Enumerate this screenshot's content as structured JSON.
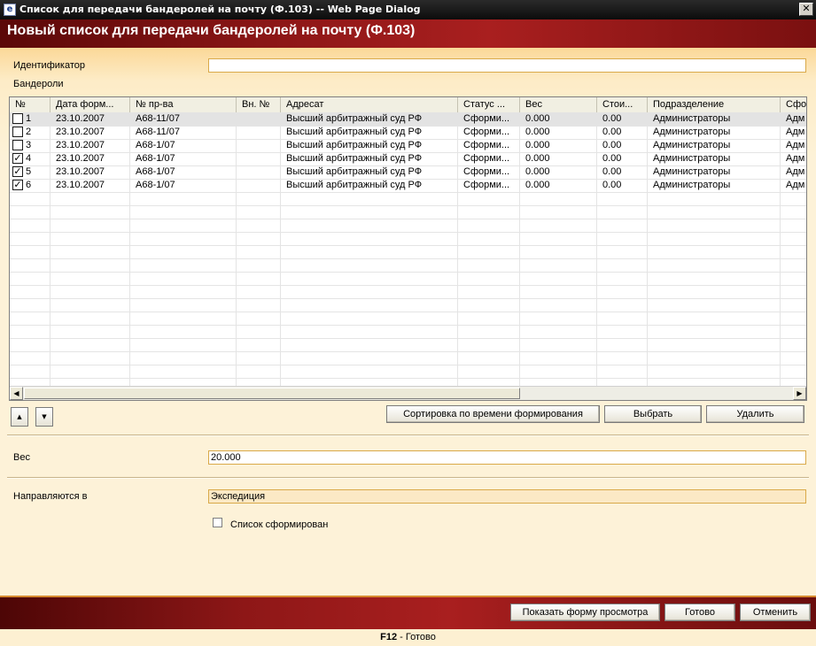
{
  "window": {
    "title": "Список для передачи бандеролей на почту (Ф.103) -- Web Page Dialog",
    "close_glyph": "✕"
  },
  "banner": {
    "title": "Новый список для передачи бандеролей на почту (Ф.103)"
  },
  "form": {
    "identifier_label": "Идентификатор",
    "identifier_value": "",
    "parcels_label": "Бандероли",
    "weight_label": "Вес",
    "weight_value": "20.000",
    "destination_label": "Направляются в",
    "destination_value": "Экспедиция",
    "list_formed_label": "Список сформирован",
    "list_formed_checked": false
  },
  "grid": {
    "columns": [
      "№",
      "Дата форм...",
      "№ пр-ва",
      "Вн. №",
      "Адресат",
      "Статус ...",
      "Вес",
      "Стои...",
      "Подразделение",
      "Сфо"
    ],
    "rows": [
      {
        "num": "1",
        "checked": false,
        "date": "23.10.2007",
        "case": "А68-11/07",
        "inner": "",
        "addressee": "Высший арбитражный суд РФ",
        "status": "Сформи...",
        "weight": "0.000",
        "cost": "0.00",
        "division": "Администраторы",
        "extra": "Адм"
      },
      {
        "num": "2",
        "checked": false,
        "date": "23.10.2007",
        "case": "А68-11/07",
        "inner": "",
        "addressee": "Высший арбитражный суд РФ",
        "status": "Сформи...",
        "weight": "0.000",
        "cost": "0.00",
        "division": "Администраторы",
        "extra": "Адм"
      },
      {
        "num": "3",
        "checked": false,
        "date": "23.10.2007",
        "case": "А68-1/07",
        "inner": "",
        "addressee": "Высший арбитражный суд РФ",
        "status": "Сформи...",
        "weight": "0.000",
        "cost": "0.00",
        "division": "Администраторы",
        "extra": "Адм"
      },
      {
        "num": "4",
        "checked": true,
        "date": "23.10.2007",
        "case": "А68-1/07",
        "inner": "",
        "addressee": "Высший арбитражный суд РФ",
        "status": "Сформи...",
        "weight": "0.000",
        "cost": "0.00",
        "division": "Администраторы",
        "extra": "Адм"
      },
      {
        "num": "5",
        "checked": true,
        "date": "23.10.2007",
        "case": "А68-1/07",
        "inner": "",
        "addressee": "Высший арбитражный суд РФ",
        "status": "Сформи...",
        "weight": "0.000",
        "cost": "0.00",
        "division": "Администраторы",
        "extra": "Адм"
      },
      {
        "num": "6",
        "checked": true,
        "date": "23.10.2007",
        "case": "А68-1/07",
        "inner": "",
        "addressee": "Высший арбитражный суд РФ",
        "status": "Сформи...",
        "weight": "0.000",
        "cost": "0.00",
        "division": "Администраторы",
        "extra": "Адм"
      }
    ],
    "selected_row": 0,
    "check_glyph": "✓",
    "scroll_left_glyph": "◀",
    "scroll_right_glyph": "▶"
  },
  "toolbar": {
    "move_up_glyph": "▲",
    "move_down_glyph": "▼",
    "sort_label": "Сортировка по времени формирования",
    "select_label": "Выбрать",
    "delete_label": "Удалить"
  },
  "footer": {
    "preview_label": "Показать форму просмотра",
    "done_label": "Готово",
    "cancel_label": "Отменить"
  },
  "status": {
    "key": "F12",
    "text": " - Готово"
  }
}
